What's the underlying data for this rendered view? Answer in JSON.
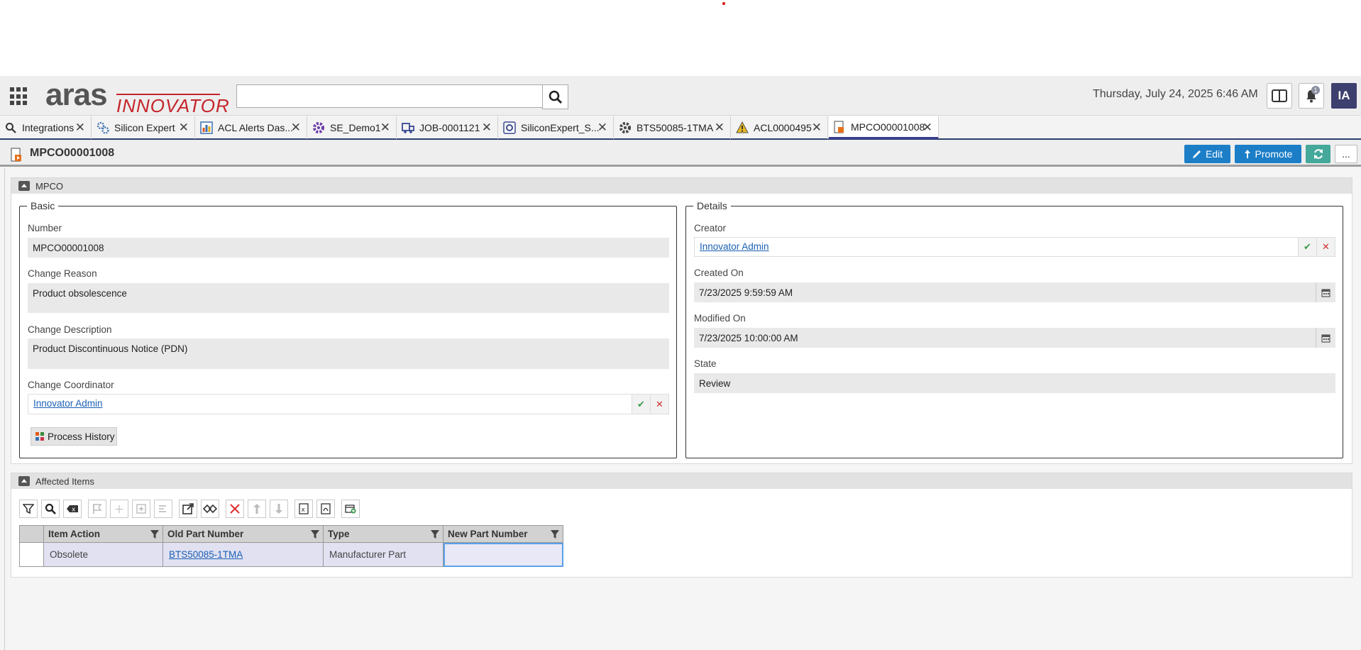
{
  "header": {
    "logo_main": "aras",
    "logo_sub": "INNOVATOR",
    "search_placeholder": "",
    "datetime": "Thursday, July 24, 2025 6:46 AM",
    "notification_count": "1",
    "user_initials": "IA"
  },
  "tabs": [
    {
      "label": "Integrations",
      "icon": "search-icon"
    },
    {
      "label": "Silicon Expert",
      "icon": "gears-icon"
    },
    {
      "label": "ACL Alerts Das...",
      "icon": "chart-icon"
    },
    {
      "label": "SE_Demo1",
      "icon": "gear-purple-icon"
    },
    {
      "label": "JOB-0001121",
      "icon": "truck-icon"
    },
    {
      "label": "SiliconExpert_S...",
      "icon": "refresh-icon"
    },
    {
      "label": "BTS50085-1TMA",
      "icon": "gear-icon"
    },
    {
      "label": "ACL0000495",
      "icon": "warning-icon"
    },
    {
      "label": "MPCO00001008",
      "icon": "document-icon",
      "active": true
    }
  ],
  "titlebar": {
    "title": "MPCO00001008",
    "edit_label": "Edit",
    "promote_label": "Promote",
    "more_label": "..."
  },
  "mpco_section": {
    "heading": "MPCO",
    "basic": {
      "legend": "Basic",
      "number_label": "Number",
      "number_value": "MPCO00001008",
      "change_reason_label": "Change Reason",
      "change_reason_value": "Product obsolescence",
      "change_description_label": "Change Description",
      "change_description_value": "Product Discontinuous Notice (PDN)",
      "change_coordinator_label": "Change Coordinator",
      "change_coordinator_value": "Innovator Admin",
      "process_history_label": "Process History"
    },
    "details": {
      "legend": "Details",
      "creator_label": "Creator",
      "creator_value": "Innovator Admin",
      "created_on_label": "Created On",
      "created_on_value": "7/23/2025 9:59:59 AM",
      "modified_on_label": "Modified On",
      "modified_on_value": "7/23/2025 10:00:00 AM",
      "state_label": "State",
      "state_value": "Review"
    }
  },
  "affected_section": {
    "heading": "Affected Items",
    "columns": [
      "Item Action",
      "Old Part Number",
      "Type",
      "New Part Number"
    ],
    "rows": [
      {
        "item_action": "Obsolete",
        "old_part_number": "BTS50085-1TMA",
        "type": "Manufacturer Part",
        "new_part_number": ""
      }
    ]
  },
  "colors": {
    "primary_button": "#1c7ec7",
    "refresh_button": "#44a89a",
    "avatar": "#3d3f6e",
    "link": "#1a5fb4",
    "logo_red": "#c5242b"
  }
}
